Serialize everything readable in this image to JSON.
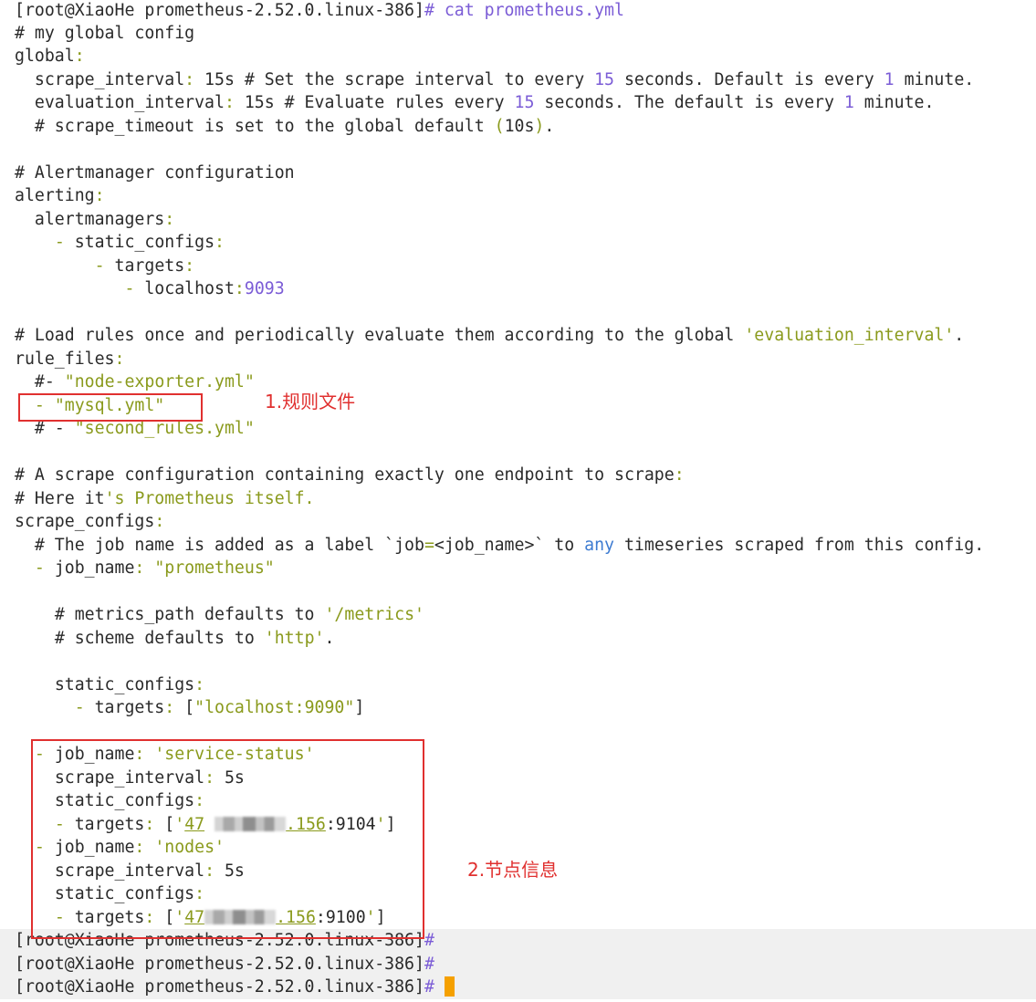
{
  "terminal": {
    "prompt": "[root@XiaoHe prometheus-2.52.0.linux-386]",
    "prompt_hash": "#",
    "command": "cat prometheus.yml",
    "lines": {
      "l02": "# my global config",
      "l03": "global",
      "l04_key": "scrape_interval",
      "l04_a": " 15s # Set the scrape interval to every ",
      "l04_n1": "15",
      "l04_b": " seconds. Default is every ",
      "l04_n2": "1",
      "l04_c": " minute.",
      "l05_key": "evaluation_interval",
      "l05_a": " 15s # Evaluate rules every ",
      "l05_n1": "15",
      "l05_b": " seconds. The default is every ",
      "l05_n2": "1",
      "l05_c": " minute.",
      "l06_a": "# scrape_timeout is set to the global default ",
      "l06_b": "10s",
      "l08": "# Alertmanager configuration",
      "l09": "alerting",
      "l10": "alertmanagers",
      "l11": "static_configs",
      "l12": "targets",
      "l13_host": "localhost",
      "l13_port": "9093",
      "l15_a": "# Load rules once and periodically evaluate them according to the global ",
      "l15_str": "'evaluation_interval'",
      "l15_b": ".",
      "l16": "rule_files",
      "l17_a": "#- ",
      "l17_str": "\"node-exporter.yml\"",
      "l18_str": "\"mysql.yml\"",
      "l19_a": "# - ",
      "l19_str": "\"second_rules.yml\"",
      "l21_a": "# A scrape configuration containing exactly one endpoint to scrape",
      "l22_a": "# Here it",
      "l22_str": "'s Prometheus itself.",
      "l23": "scrape_configs",
      "l24_a": "# The job name is added as a label `job",
      "l24_b": "<job_name>` to ",
      "l24_kw": "any",
      "l24_c": " timeseries scraped from this config.",
      "l25_key": "job_name",
      "l25_str": "\"prometheus\"",
      "l27_a": "# metrics_path defaults to ",
      "l27_str": "'/metrics'",
      "l28_a": "# scheme defaults to ",
      "l28_str": "'http'",
      "l28_b": ".",
      "l30": "static_configs",
      "l31_key": "targets",
      "l31_str": "\"localhost:9090\"",
      "l33_key": "job_name",
      "l33_str": "'service-status'",
      "l34_key": "scrape_interval",
      "l34_val": " 5s",
      "l35": "static_configs",
      "l36_key": "targets",
      "l36_ip1": "47",
      "l36_ip2": ".156",
      "l36_port": ":9104",
      "l37_key": "job_name",
      "l37_str": "'nodes'",
      "l38_key": "scrape_interval",
      "l38_val": " 5s",
      "l39": "static_configs",
      "l40_key": "targets",
      "l40_ip1": "47",
      "l40_ip2": ".156",
      "l40_port": ":9100"
    }
  },
  "annotations": {
    "rule_label": "1.规则文件",
    "nodes_label": "2.节点信息"
  },
  "colors": {
    "accent_red": "#e0302f",
    "string_olive": "#8a9a1c",
    "number_purple": "#7b5cd6",
    "keyword_blue": "#3d7bd1",
    "cursor": "#f5a000"
  }
}
